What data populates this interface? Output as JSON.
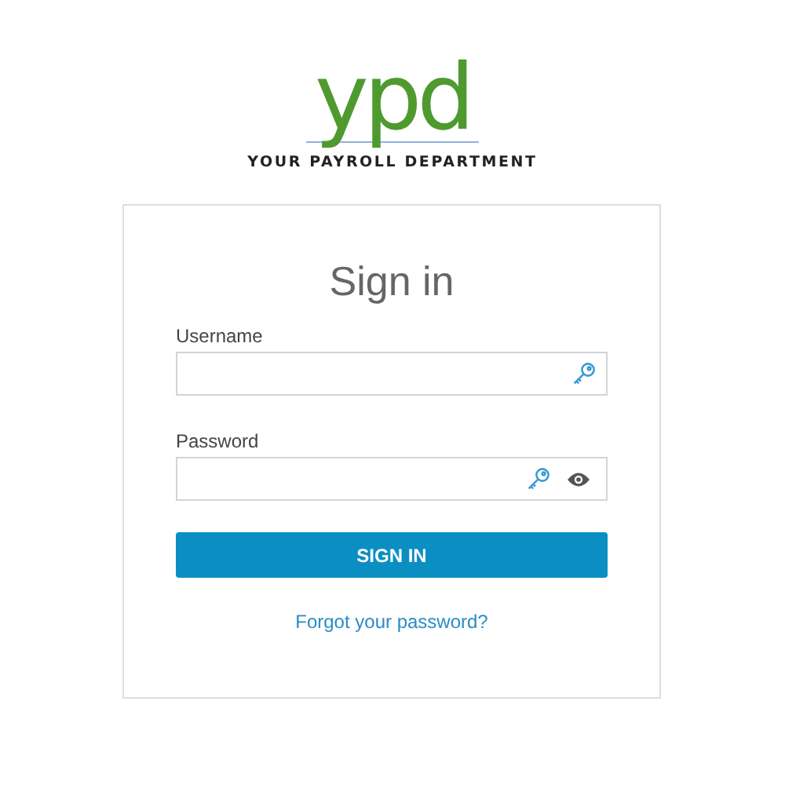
{
  "logo": {
    "mark": "ypd",
    "tagline": "YOUR PAYROLL DEPARTMENT"
  },
  "form": {
    "title": "Sign in",
    "fields": [
      {
        "label": "Username",
        "reveal_toggle": false
      },
      {
        "label": "Password",
        "reveal_toggle": true
      }
    ],
    "submit": "SIGN IN",
    "link": "Forgot your password?"
  }
}
